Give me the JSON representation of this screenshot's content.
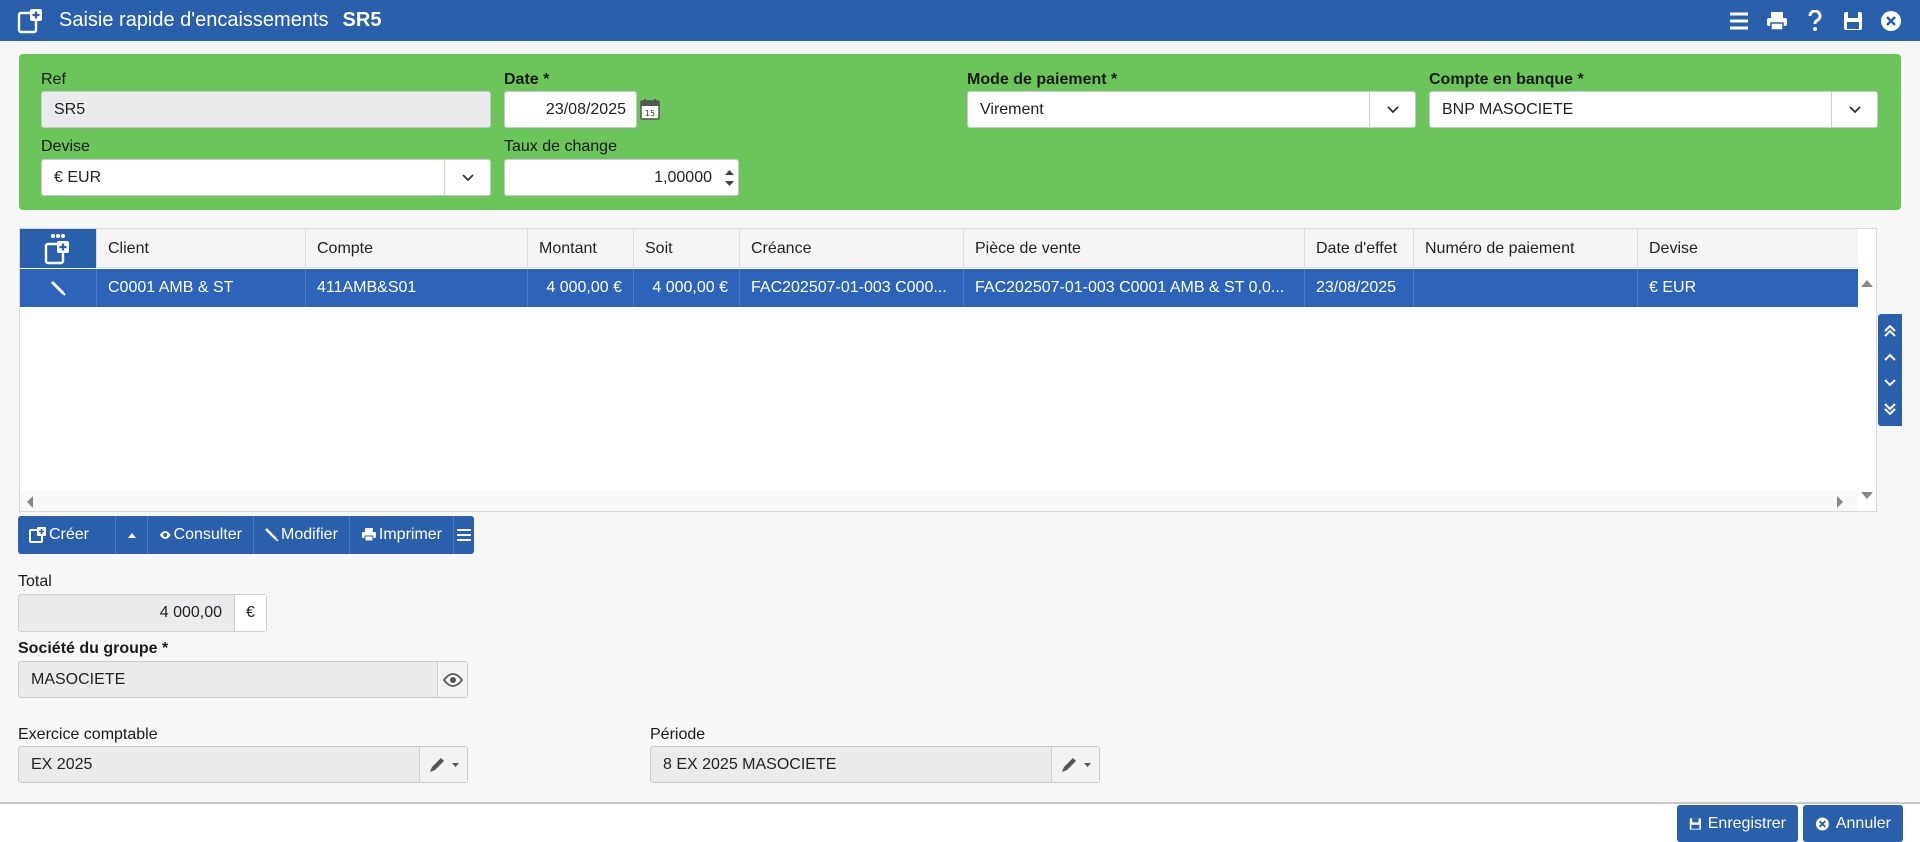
{
  "title": {
    "text": "Saisie rapide d'encaissements",
    "ref": "SR5"
  },
  "header": {
    "ref": {
      "label": "Ref",
      "value": "SR5"
    },
    "date": {
      "label": "Date *",
      "value": "23/08/2025"
    },
    "mode_paiement": {
      "label": "Mode de paiement *",
      "value": "Virement"
    },
    "compte_banque": {
      "label": "Compte en banque *",
      "value": "BNP MASOCIETE"
    },
    "devise": {
      "label": "Devise",
      "value": "€ EUR"
    },
    "taux_change": {
      "label": "Taux de change",
      "value": "1,00000"
    }
  },
  "grid": {
    "columns": [
      "Client",
      "Compte",
      "Montant",
      "Soit",
      "Créance",
      "Pièce de vente",
      "Date d'effet",
      "Numéro de paiement",
      "Devise"
    ],
    "rows": [
      {
        "client": "C0001 AMB & ST",
        "compte": "411AMB&S01",
        "montant": "4 000,00 €",
        "soit": "4 000,00 €",
        "creance": "FAC202507-01-003 C000...",
        "piece_vente": "FAC202507-01-003 C0001 AMB & ST 0,0...",
        "date_effet": "23/08/2025",
        "numero_paiement": "",
        "devise": "€ EUR"
      }
    ]
  },
  "toolbar": {
    "creer": "Créer",
    "consulter": "Consulter",
    "modifier": "Modifier",
    "imprimer": "Imprimer"
  },
  "total": {
    "label": "Total",
    "value": "4 000,00",
    "currency": "€"
  },
  "societe": {
    "label": "Société du groupe *",
    "value": "MASOCIETE"
  },
  "exercice": {
    "label": "Exercice comptable",
    "value": "EX 2025"
  },
  "periode": {
    "label": "Période",
    "value": "8 EX 2025 MASOCIETE"
  },
  "footer": {
    "enregistrer": "Enregistrer",
    "annuler": "Annuler"
  },
  "colors": {
    "primary": "#2a5fac",
    "header_green": "#6cc55a",
    "selected_row": "#2d63b8"
  }
}
